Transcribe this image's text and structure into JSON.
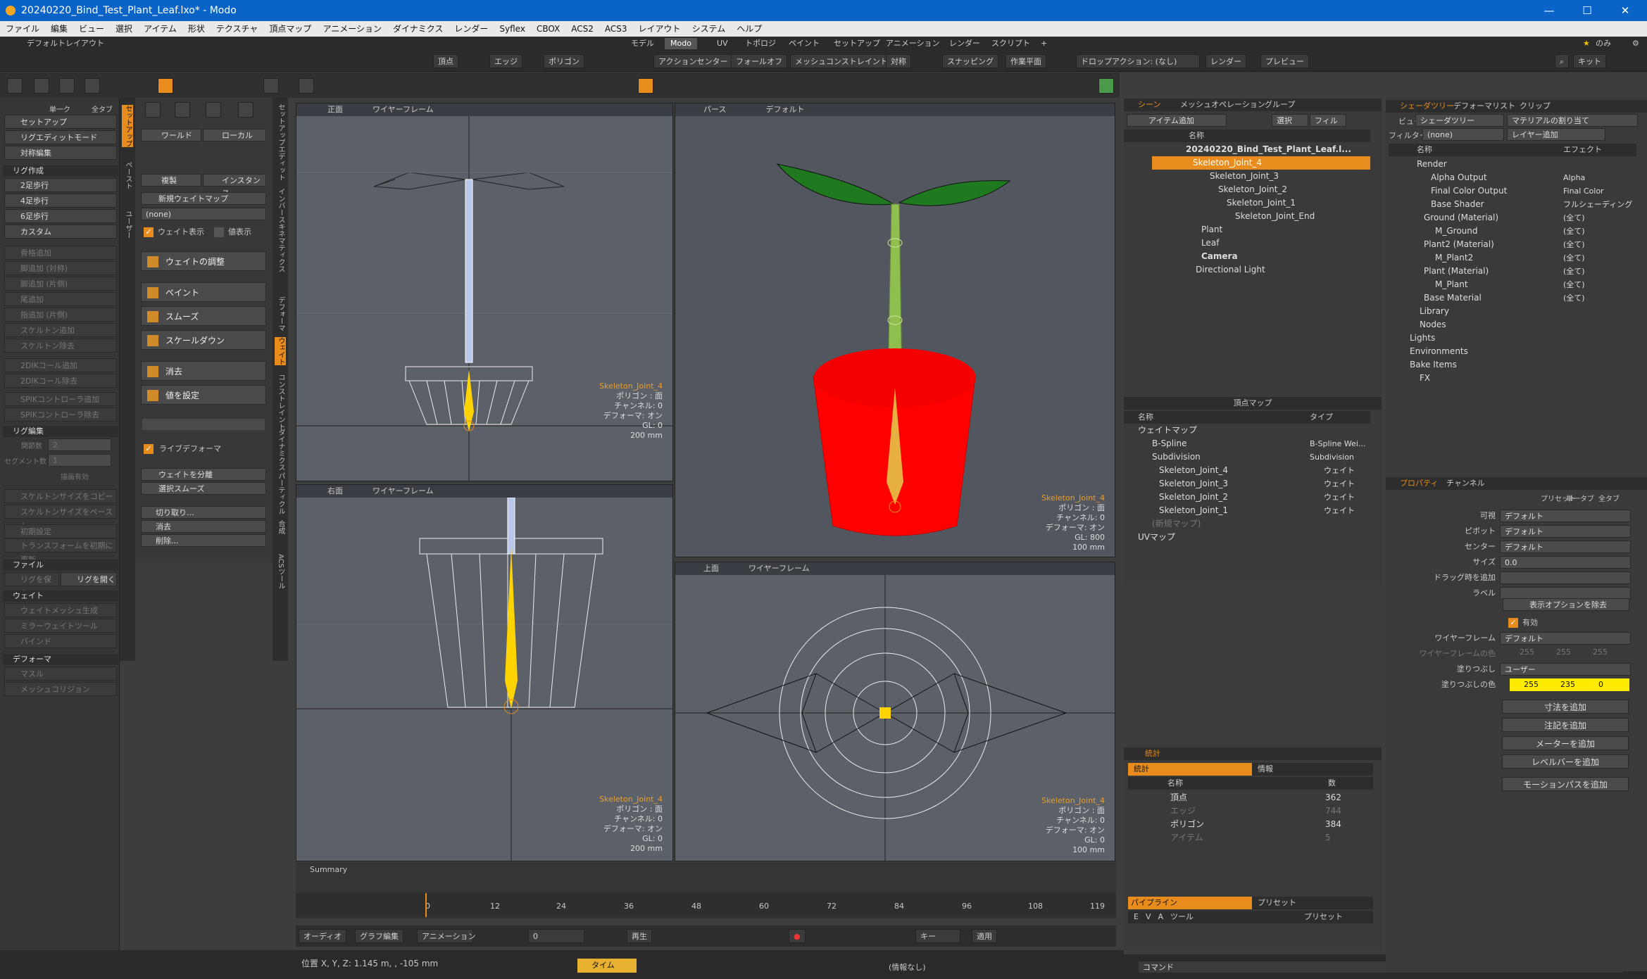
{
  "window": {
    "title": "20240220_Bind_Test_Plant_Leaf.lxo* - Modo",
    "min": "—",
    "max": "☐",
    "close": "✕"
  },
  "menu": [
    "ファイル",
    "編集",
    "ビュー",
    "選択",
    "アイテム",
    "形状",
    "テクスチャ",
    "頂点マップ",
    "アニメーション",
    "ダイナミクス",
    "レンダー",
    "Syflex",
    "CBOX",
    "ACS2",
    "ACS3",
    "レイアウト",
    "システム",
    "ヘルプ"
  ],
  "layout": {
    "name": "デフォルトレイアウト",
    "tabs": [
      "モデル",
      "Modo",
      "UV",
      "トポロジ",
      "ペイント",
      "セットアップ",
      "アニメーション",
      "レンダー",
      "スクリプト",
      "+"
    ],
    "active_tab": "Modo",
    "right_label": "のみ"
  },
  "toolbar": {
    "vertex": "頂点",
    "edge": "エッジ",
    "polygon": "ポリゴン",
    "action_center": "アクションセンター",
    "falloff": "フォールオフ",
    "mesh_constraint": "メッシュコンストレイント",
    "symmetry": "対称",
    "snapping": "スナッピング",
    "workplane": "作業平面",
    "drop_action": "ドロップアクション: (なし)",
    "render": "レンダー",
    "preview": "プレビュー",
    "kit": "キット"
  },
  "left": {
    "mode_label": "単一ク",
    "all_label": "全タブ",
    "items": [
      "セットアップ",
      "リグエディットモード",
      "対称編集"
    ],
    "rig_header": "リグ作成",
    "rig_items": [
      "2足歩行",
      "4足歩行",
      "6足歩行",
      "カスタム"
    ],
    "disabled": [
      "骨格追加",
      "脚追加 (対称)",
      "脚追加 (片側)",
      "尾追加",
      "指追加 (片側)",
      "スケルトン追加",
      "スケルトン除去",
      "2DIKコール追加",
      "2DIKコール除去",
      "SPIKコントローラ追加",
      "SPIKコントローラ除去"
    ],
    "edit_header": "リグ編集",
    "joint_count_label": "関節数",
    "joint_count": "2",
    "segment_label": "セグメント数",
    "segment": "1",
    "sub_label": "描画有効",
    "copy_size": "スケルトンサイズをコピー",
    "paste_size": "スケルトンサイズをペースト",
    "init_pose": "初期設定",
    "transform": "トランスフォームを初期に更新",
    "file_header": "ファイル",
    "save_rig": "リグを保存",
    "open_rig": "リグを開く",
    "weight_header": "ウェイト",
    "weight_items": [
      "ウェイトメッシュ生成",
      "ミラーウェイトツール",
      "バインド"
    ],
    "deformer_header": "デフォーマ",
    "deformer_items": [
      "マスル",
      "メッシュコリジョン"
    ]
  },
  "vtabs1": [
    "セットアップ",
    "ペースト",
    "ユーザー"
  ],
  "mid": {
    "world": "ワールド",
    "local": "ローカル",
    "duplicate": "複製",
    "instance": "インスタンス",
    "new_weightmap": "新規ウェイトマップ",
    "none": "(none)",
    "weight_display": "ウェイト表示",
    "value_display": "値表示",
    "adjust": "ウェイトの調整",
    "paint": "ペイント",
    "smooth": "スムーズ",
    "scale_down": "スケールダウン",
    "erase": "消去",
    "set_value": "値を設定",
    "live_deformer": "ライブデフォーマ",
    "split": "ウェイトを分離",
    "select_smooth": "選択スムーズ",
    "cut": "切り取り...",
    "delete": "消去",
    "remove": "削除..."
  },
  "vtabs2": [
    "セットアップ",
    "エディット",
    "インバースキネマティクス",
    "デフォーマ",
    "ウェイト",
    "コンストレイント",
    "ダイナミクス",
    "パーティクル",
    "合成",
    "ACSツール"
  ],
  "viewports": [
    {
      "view": "正面",
      "shade": "ワイヤーフレーム",
      "joint": "Skeleton_Joint_4",
      "poly": "ポリゴン : 面",
      "ch": "チャンネル: 0",
      "def": "デフォーマ: オン",
      "gl": "GL: 0",
      "scale": "200 mm"
    },
    {
      "view": "パース",
      "shade": "デフォルト",
      "joint": "Skeleton_Joint_4",
      "poly": "ポリゴン : 面",
      "ch": "チャンネル: 0",
      "def": "デフォーマ: オン",
      "gl": "GL: 800",
      "scale": "100 mm"
    },
    {
      "view": "右面",
      "shade": "ワイヤーフレーム",
      "joint": "Skeleton_Joint_4",
      "poly": "ポリゴン : 面",
      "ch": "チャンネル: 0",
      "def": "デフォーマ: オン",
      "gl": "GL: 0",
      "scale": "200 mm"
    },
    {
      "view": "上面",
      "shade": "ワイヤーフレーム",
      "joint": "Skeleton_Joint_4",
      "poly": "ポリゴン : 面",
      "ch": "チャンネル: 0",
      "def": "デフォーマ: オン",
      "gl": "GL: 0",
      "scale": "100 mm"
    }
  ],
  "scene": {
    "tabs": [
      "シーン",
      "メッシュオペレーション",
      "グループ"
    ],
    "add_item": "アイテム追加",
    "select": "選択",
    "filter": "フィル",
    "col_name": "名称",
    "items": [
      "20240220_Bind_Test_Plant_Leaf.l...",
      "Skeleton_Joint_4",
      "Skeleton_Joint_3",
      "Skeleton_Joint_2",
      "Skeleton_Joint_1",
      "Skeleton_Joint_End",
      "Plant",
      "Leaf",
      "Camera",
      "Directional Light"
    ]
  },
  "vmap": {
    "title": "頂点マップ",
    "col_name": "名称",
    "col_type": "タイプ",
    "rows": [
      [
        "ウェイトマップ",
        ""
      ],
      [
        "B-Spline",
        "B-Spline Wei..."
      ],
      [
        "Subdivision",
        "Subdivision"
      ],
      [
        "Skeleton_Joint_4",
        "ウェイト"
      ],
      [
        "Skeleton_Joint_3",
        "ウェイト"
      ],
      [
        "Skeleton_Joint_2",
        "ウェイト"
      ],
      [
        "Skeleton_Joint_1",
        "ウェイト"
      ],
      [
        "(新規マップ)",
        ""
      ],
      [
        "UVマップ",
        ""
      ]
    ]
  },
  "stats": {
    "tab": "統計",
    "info": "情報",
    "col_name": "名称",
    "col_num": "数",
    "rows": [
      [
        "頂点",
        "362"
      ],
      [
        "エッジ",
        "744"
      ],
      [
        "ポリゴン",
        "384"
      ],
      [
        "アイテム",
        "5"
      ]
    ]
  },
  "pipeline": {
    "tab": "パイプライン",
    "preset": "プリセット",
    "cols": [
      "E",
      "V",
      "A",
      "ツール",
      "プリセット"
    ]
  },
  "shader": {
    "tabs": [
      "シェーダツリー",
      "デフォーマリスト",
      "クリップ"
    ],
    "view_label": "ビュー",
    "view": "シェーダツリー",
    "assign": "マテリアルの割り当て",
    "filter_label": "フィルター",
    "filter": "(none)",
    "layer_add": "レイヤー追加",
    "col_name": "名称",
    "col_effect": "エフェクト",
    "rows": [
      [
        "Render",
        ""
      ],
      [
        "Alpha Output",
        "Alpha"
      ],
      [
        "Final Color Output",
        "Final Color"
      ],
      [
        "Base Shader",
        "フルシェーディング"
      ],
      [
        "Ground (Material)",
        "(全て)"
      ],
      [
        "M_Ground",
        "(全て)"
      ],
      [
        "Plant2 (Material)",
        "(全て)"
      ],
      [
        "M_Plant2",
        "(全て)"
      ],
      [
        "Plant (Material)",
        "(全て)"
      ],
      [
        "M_Plant",
        "(全て)"
      ],
      [
        "Base Material",
        "(全て)"
      ],
      [
        "Library",
        ""
      ],
      [
        "Nodes",
        ""
      ],
      [
        "Lights",
        ""
      ],
      [
        "Environments",
        ""
      ],
      [
        "Bake Items",
        ""
      ],
      [
        "FX",
        ""
      ]
    ]
  },
  "props": {
    "tabs": [
      "プロパティ",
      "チャンネル"
    ],
    "preset": "プリセット",
    "single": "単一タブ",
    "all": "全タブ",
    "rows": [
      [
        "可視",
        "デフォルト"
      ],
      [
        "ピボット",
        "デフォルト"
      ],
      [
        "センター",
        "デフォルト"
      ],
      [
        "サイズ",
        "0.0"
      ],
      [
        "ドラッグ時を追加",
        ""
      ],
      [
        "ラベル",
        ""
      ]
    ],
    "remove_opts": "表示オプションを除去",
    "enabled": "有効",
    "wire_label": "ワイヤーフレーム",
    "wire": "デフォルト",
    "wire_color_label": "ワイヤーフレームの色",
    "wire_color": [
      "255",
      "255",
      "255"
    ],
    "fill_label": "塗りつぶし",
    "fill": "ユーザー",
    "fill_color_label": "塗りつぶしの色",
    "fill_color": [
      "255",
      "235",
      "0"
    ],
    "buttons": [
      "寸法を追加",
      "注記を追加",
      "メーターを追加",
      "レベルバーを追加",
      "モーションパスを追加"
    ]
  },
  "timeline": {
    "summary": "Summary",
    "ticks": [
      "0",
      "12",
      "24",
      "36",
      "48",
      "60",
      "72",
      "84",
      "96",
      "108",
      "119"
    ],
    "range_start": "0",
    "range_end": "119",
    "range_mid": "119"
  },
  "controls": {
    "audio": "オーディオ",
    "graph": "グラフ編集",
    "anim": "アニメーション",
    "frame": "0",
    "play": "再生",
    "key": "キー",
    "apply": "適用"
  },
  "status": {
    "pos": "位置 X, Y, Z:  1.145 m, , -105 mm",
    "time": "タイム",
    "info": "(情報なし)",
    "command": "コマンド"
  },
  "colors": {
    "accent": "#e88c1e",
    "title": "#0a64c8",
    "pot": "#ff0000",
    "leaf": "#1f7a1f",
    "bone": "#ffd400",
    "viewport": "#5c6068"
  }
}
